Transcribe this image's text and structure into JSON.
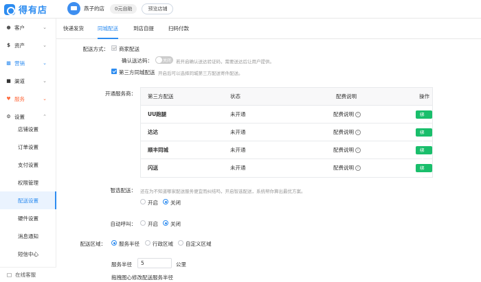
{
  "header": {
    "logo_text": "得有店",
    "store_name": "燕子的店",
    "plan_badge": "0元自助",
    "preview_label": "预览店铺"
  },
  "sidebar": {
    "items": [
      {
        "label": "客户",
        "icon": "user-icon",
        "color": "#333333"
      },
      {
        "label": "资产",
        "icon": "dollar-icon",
        "color": "#333333"
      },
      {
        "label": "营销",
        "icon": "chart-icon",
        "color": "#2d8cf0"
      },
      {
        "label": "渠道",
        "icon": "channel-icon",
        "color": "#333333"
      },
      {
        "label": "服务",
        "icon": "heart-icon",
        "color": "#ff6a3d"
      },
      {
        "label": "设置",
        "icon": "gear-icon",
        "color": "#333333"
      }
    ],
    "sub_items": [
      "店铺设置",
      "订单设置",
      "支付设置",
      "权限管理",
      "配送设置",
      "硬件设置",
      "消息通知",
      "短信中心"
    ],
    "active_sub": "配送设置",
    "online_service": "在线客服"
  },
  "tabs": [
    "快递发货",
    "同城配送",
    "到店自提",
    "扫码付款"
  ],
  "active_tab": "同城配送",
  "delivery": {
    "method_label": "配送方式：",
    "merchant_delivery": "商家配送",
    "confirm_code_label": "确认送达码：",
    "toggle_text": "关闭",
    "confirm_code_hint": "若开启确认送达验证码，需要送达后让用户提供。",
    "third_party_label": "第三方同城配送",
    "third_party_hint": "开启后可以选择同城第三方配送寄件配送。"
  },
  "service": {
    "label": "开通服务商：",
    "columns": [
      "第三方配送",
      "状态",
      "配费说明",
      "操作"
    ],
    "rows": [
      {
        "name": "UU跑腿",
        "status": "未开通",
        "fee": "配费说明",
        "action": "绑定"
      },
      {
        "name": "达达",
        "status": "未开通",
        "fee": "配费说明",
        "action": "绑定"
      },
      {
        "name": "顺丰同城",
        "status": "未开通",
        "fee": "配费说明",
        "action": "绑定"
      },
      {
        "name": "闪送",
        "status": "未开通",
        "fee": "配费说明",
        "action": "绑定"
      }
    ],
    "bind_color": "#19be6b"
  },
  "smart": {
    "label": "智选配送：",
    "hint": "还在为不知道哪家配送服务便宜而纠结吗，开启智选配送，系统帮你算出最优方案。",
    "on": "开启",
    "off": "关闭"
  },
  "auto_call": {
    "label": "自动呼叫：",
    "on": "开启",
    "off": "关闭"
  },
  "area": {
    "label": "配送区域：",
    "options": [
      "服务半径",
      "行政区域",
      "自定义区域"
    ],
    "radius_label": "服务半径",
    "radius_value": "5",
    "unit": "公里",
    "drag_hint": "拖拽图心修改配送服务半径"
  },
  "accent_color": "#2d8cf0"
}
